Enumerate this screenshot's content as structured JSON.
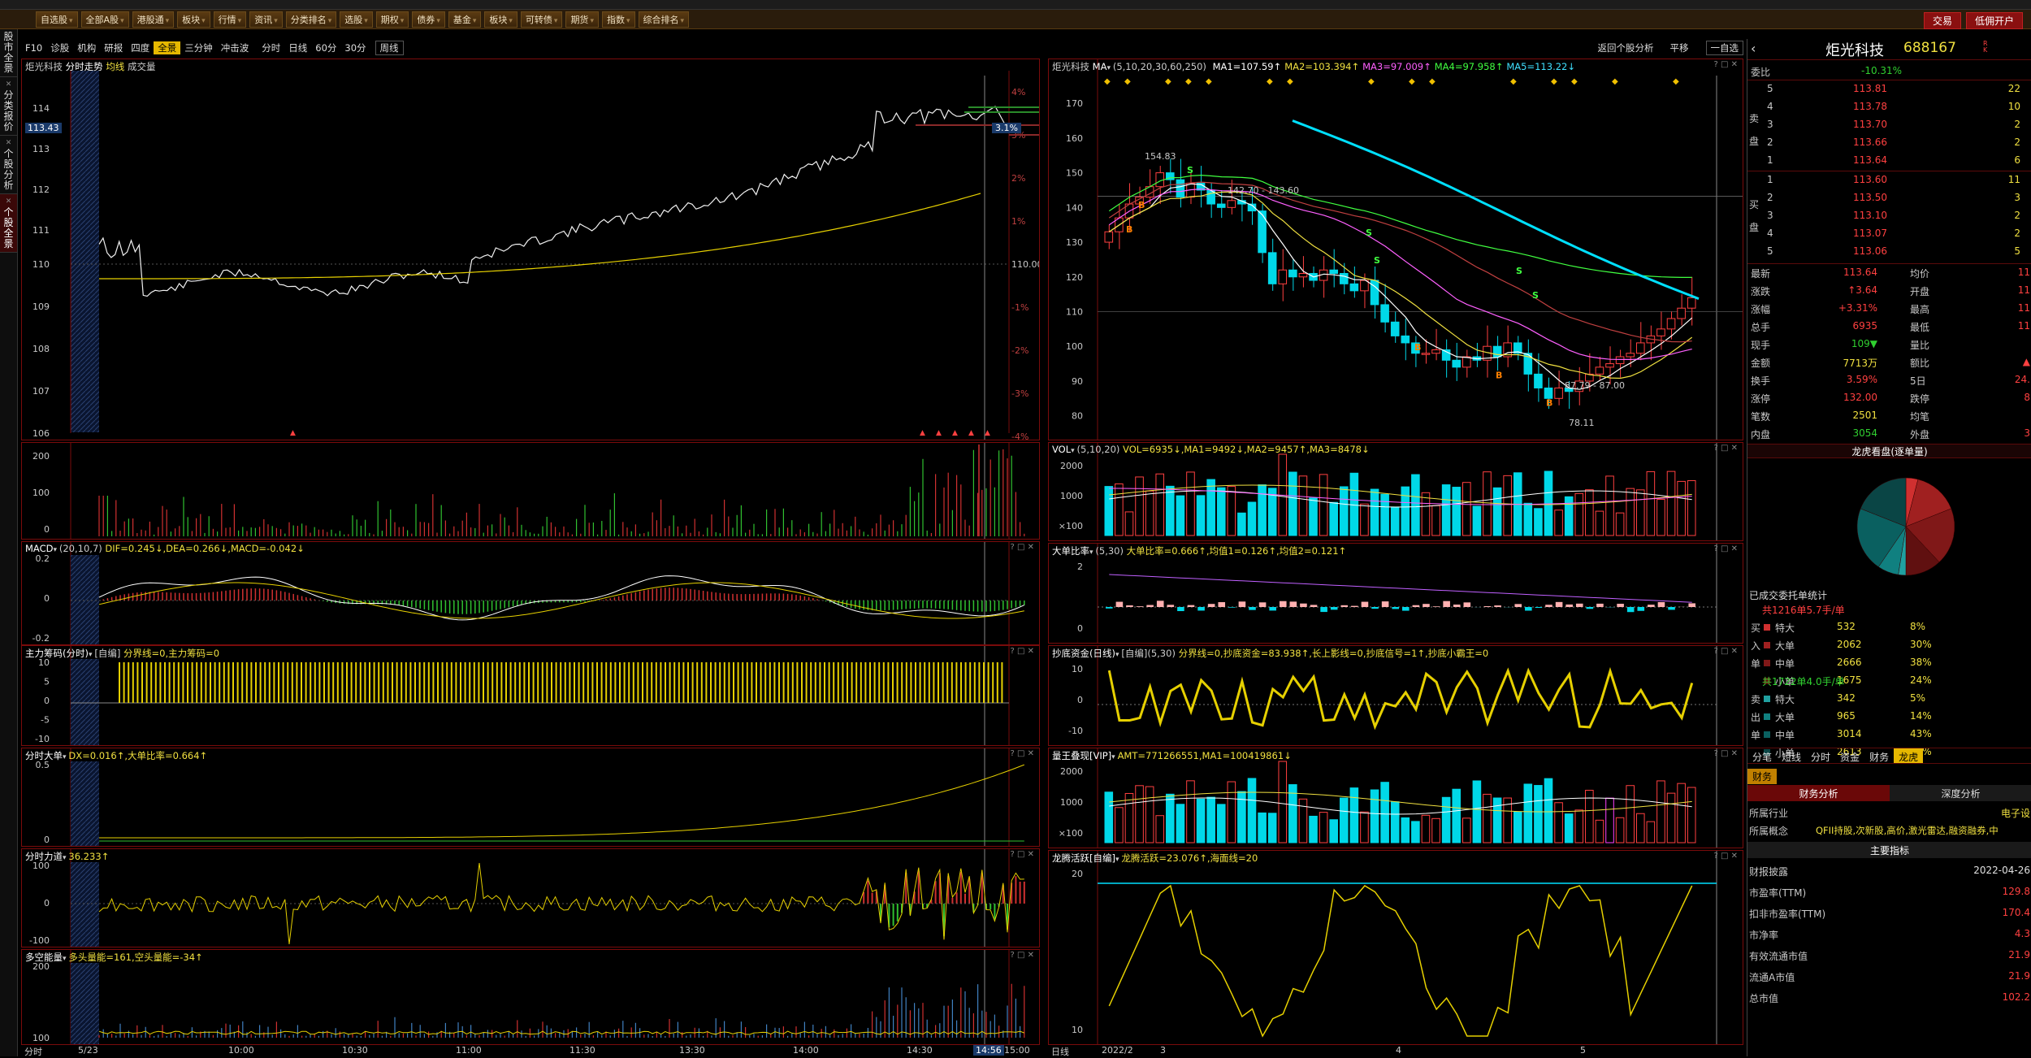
{
  "toolbar": {
    "items": [
      "自选股",
      "全部A股",
      "港股通",
      "板块",
      "行情",
      "资讯",
      "分类排名",
      "选股",
      "期权",
      "债券",
      "基金",
      "板块",
      "可转债",
      "期货",
      "指数",
      "综合排名"
    ],
    "right": [
      "交易",
      "低佣开户"
    ]
  },
  "leftbar": [
    "股市全景",
    "分类报价",
    "个股分析",
    "个股全景"
  ],
  "subbar": {
    "tabs": [
      "F10",
      "诊股",
      "机构",
      "研报",
      "四度",
      "全景",
      "三分钟",
      "冲击波"
    ],
    "active": "全景",
    "periods": [
      "分时",
      "日线",
      "60分",
      "30分",
      "周线"
    ],
    "right": [
      "返回个股分析",
      "平移",
      "一自选"
    ]
  },
  "intraday": {
    "title": "炬光科技",
    "sub": "分时走势",
    "ma_label": "均线",
    "vol_label": "成交量",
    "price_ticks": [
      "114",
      "113",
      "112",
      "111",
      "110",
      "109",
      "108",
      "107",
      "106"
    ],
    "pct_ticks": [
      "4%",
      "3%",
      "2%",
      "1%",
      "110.00",
      "-1%",
      "-2%",
      "-3%",
      "-4%"
    ],
    "cur_price": "113.43",
    "cur_pct": "3.1%",
    "time_ticks": [
      "5/23",
      "10:00",
      "10:30",
      "11:00",
      "11:30",
      "13:30",
      "14:00",
      "14:30",
      "14:56",
      "15:00"
    ],
    "corner": "分时"
  },
  "ind_left": [
    {
      "name": "MACD",
      "params": "(20,10,7)",
      "vals": "DIF=0.245↓,DEA=0.266↓,MACD=-0.042↓",
      "ticks": [
        "0.2",
        "0",
        "-0.2"
      ]
    },
    {
      "name": "主力筹码(分时)",
      "params": "[自编]",
      "vals": "分界线=0,主力筹码=0",
      "ticks": [
        "10",
        "5",
        "0",
        "-5",
        "-10"
      ]
    },
    {
      "name": "分时大单",
      "params": "",
      "vals": "DX=0.016↑,大单比率=0.664↑",
      "ticks": [
        "0.5",
        "0"
      ]
    },
    {
      "name": "分时力道",
      "params": "",
      "vals": "36.233↑",
      "ticks": [
        "100",
        "0",
        "-100"
      ]
    },
    {
      "name": "多空能量",
      "params": "",
      "vals": "多头量能=161,空头量能=-34↑",
      "ticks": [
        "200",
        "100"
      ]
    }
  ],
  "vol_ticks_left": [
    "200",
    "100",
    "0"
  ],
  "kline": {
    "title": "炬光科技",
    "ma_hdr": "MA",
    "ma_params": "(5,10,20,30,60,250)",
    "mas": [
      "MA1=107.59↑",
      "MA2=103.394↑",
      "MA3=97.009↑",
      "MA4=97.958↑",
      "MA5=113.22↓"
    ],
    "price_ticks": [
      "170",
      "160",
      "150",
      "140",
      "130",
      "120",
      "110",
      "100",
      "90",
      "80"
    ],
    "annot_hi": "154.83",
    "annot_range": "142.70 - 143.60",
    "annot_mid": "87.79 - 87.00",
    "annot_lo": "78.11",
    "time_ticks": [
      "2022/2",
      "3",
      "4",
      "5"
    ],
    "corner": "日线"
  },
  "ind_right": [
    {
      "name": "VOL",
      "params": "(5,10,20)",
      "vals": "VOL=6935↓,MA1=9492↓,MA2=9457↑,MA3=8478↓",
      "ticks": [
        "2000",
        "1000",
        "×100"
      ]
    },
    {
      "name": "大单比率",
      "params": "(5,30)",
      "vals": "大单比率=0.666↑,均值1=0.126↑,均值2=0.121↑",
      "ticks": [
        "2",
        "0"
      ]
    },
    {
      "name": "抄底资金(日线)",
      "params": "[自编](5,30)",
      "vals": "分界线=0,抄底资金=83.938↑,长上影线=0,抄底信号=1↑,抄底小霸王=0",
      "ticks": [
        "10",
        "0",
        "-10"
      ]
    },
    {
      "name": "量王叠现[VIP]",
      "params": "",
      "vals": "AMT=771266551,MA1=100419861↓",
      "ticks": [
        "2000",
        "1000",
        "×100"
      ]
    },
    {
      "name": "龙腾活跃[自编]",
      "params": "",
      "vals": "龙腾活跃=23.076↑,海面线=20",
      "ticks": [
        "20",
        "10"
      ]
    }
  ],
  "quote": {
    "name": "炬光科技",
    "code": "688167",
    "badge": "R K",
    "wb_label": "委比",
    "wb": "-10.31%",
    "sells": [
      [
        "5",
        "113.81",
        "22"
      ],
      [
        "4",
        "113.78",
        "10"
      ],
      [
        "3",
        "113.70",
        "2"
      ],
      [
        "2",
        "113.66",
        "2"
      ],
      [
        "1",
        "113.64",
        "6"
      ]
    ],
    "buys": [
      [
        "1",
        "113.60",
        "11"
      ],
      [
        "2",
        "113.50",
        "3"
      ],
      [
        "3",
        "113.10",
        "2"
      ],
      [
        "4",
        "113.07",
        "2"
      ],
      [
        "5",
        "113.06",
        "5"
      ]
    ],
    "side_sell": "卖盘",
    "side_buy": "买盘",
    "stats": [
      [
        "最新",
        "113.64",
        "均价",
        "11"
      ],
      [
        "涨跌",
        "↑3.64",
        "开盘",
        "11"
      ],
      [
        "涨幅",
        "+3.31%",
        "最高",
        "11"
      ],
      [
        "总手",
        "6935",
        "最低",
        "11"
      ],
      [
        "现手",
        "109▼",
        "量比",
        ""
      ],
      [
        "金额",
        "7713万",
        "额比",
        "▲"
      ],
      [
        "换手",
        "3.59%",
        "5日",
        "24."
      ],
      [
        "涨停",
        "132.00",
        "跌停",
        "8"
      ],
      [
        "笔数",
        "2501",
        "均笔",
        ""
      ],
      [
        "内盘",
        "3054",
        "外盘",
        "3"
      ]
    ]
  },
  "dragon": {
    "title": "龙虎看盘(逐单量)",
    "deal_title": "已成交委托单统计",
    "g1": "共1216单5.7手/单",
    "g1rows": [
      [
        "特大",
        "532",
        "8%"
      ],
      [
        "大单",
        "2062",
        "30%"
      ],
      [
        "中单",
        "2666",
        "38%"
      ],
      [
        "小单",
        "1675",
        "24%"
      ]
    ],
    "g1side": [
      "买",
      "入",
      "单"
    ],
    "g2": "共1722单4.0手/单",
    "g2rows": [
      [
        "特大",
        "342",
        "5%"
      ],
      [
        "大单",
        "965",
        "14%"
      ],
      [
        "中单",
        "3014",
        "43%"
      ],
      [
        "小单",
        "2613",
        "38%"
      ]
    ],
    "g2side": [
      "卖",
      "出",
      "单"
    ]
  },
  "rtabs": [
    "分笔",
    "短线",
    "分时",
    "资金",
    "财务",
    "龙虎"
  ],
  "fin": {
    "tab": "财务",
    "tabs": [
      "财务分析",
      "深度分析"
    ],
    "industry_l": "所属行业",
    "industry": "电子设",
    "concept_l": "所属概念",
    "concept": "QFII持股,次新股,高价,激光雷达,融资融券,中",
    "main_idx": "主要指标",
    "rows": [
      [
        "财报披露",
        "2022-04-26"
      ],
      [
        "市盈率(TTM)",
        "129.8"
      ],
      [
        "扣非市盈率(TTM)",
        "170.4"
      ],
      [
        "市净率",
        "4.3"
      ],
      [
        "有效流通市值",
        "21.9"
      ],
      [
        "流通A市值",
        "21.9"
      ],
      [
        "总市值",
        "102.2"
      ]
    ]
  },
  "colors": {
    "accent": "#e6b800",
    "up": "#ff4040",
    "down": "#30d030",
    "border": "#7a0b0b",
    "cyan": "#00e0ff"
  }
}
